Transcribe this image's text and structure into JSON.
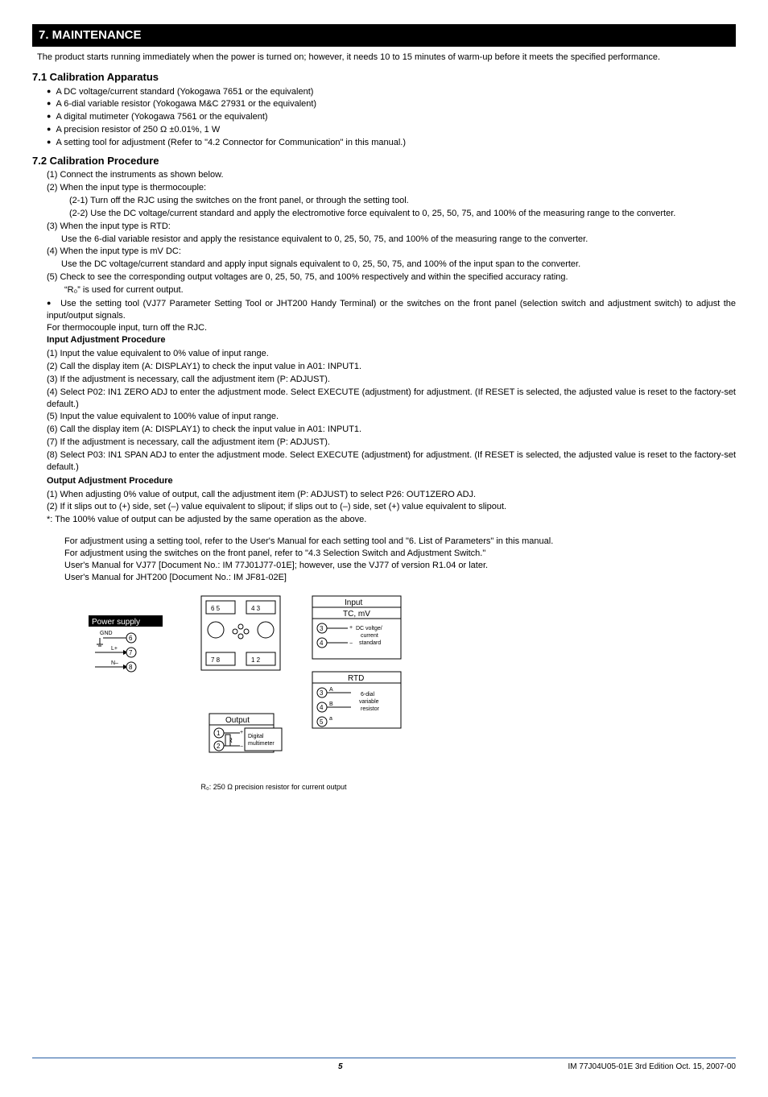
{
  "header": "7. MAINTENANCE",
  "intro": "The product starts running immediately when the power is turned on; however, it needs 10 to 15 minutes of warm-up before it meets the specified performance.",
  "s71": {
    "title": "7.1    Calibration Apparatus",
    "items": [
      "A DC voltage/current standard (Yokogawa 7651 or the equivalent)",
      "A 6-dial variable resistor (Yokogawa M&C 27931 or the equivalent)",
      "A digital mutimeter (Yokogawa 7561 or the equivalent)",
      "A precision resistor of 250 Ω ±0.01%, 1 W",
      "A setting tool for adjustment (Refer to \"4.2 Connector for Communication\" in this manual.)"
    ]
  },
  "s72": {
    "title": "7.2    Calibration Procedure",
    "p1": "(1) Connect the instruments as shown below.",
    "p2": "(2) When the input type is thermocouple:",
    "p2_1": "(2-1) Turn off the RJC using the switches on the front panel, or through the setting tool.",
    "p2_2": "(2-2) Use the DC voltage/current standard and apply the electromotive force equivalent to 0, 25, 50, 75, and 100% of the measuring range to the converter.",
    "p3": "(3) When the input type is RTD:",
    "p3s": "Use the 6-dial variable resistor and apply the resistance equivalent to 0, 25, 50, 75, and 100% of the measuring range to the converter.",
    "p4": "(4) When the input type is mV DC:",
    "p4s": "Use the DC voltage/current standard and apply input signals equivalent to 0, 25, 50, 75, and 100% of the input span to the converter.",
    "p5": "(5) Check to see the corresponding output voltages are 0, 25, 50, 75, and 100% respectively and within the specified accuracy rating.",
    "p5s": "“R₀” is used for current output.",
    "b1": "Use the setting tool (VJ77 Parameter Setting Tool or JHT200 Handy Terminal) or the switches on the front panel (selection switch and adjustment switch) to adjust the input/output signals.",
    "b1s": "For thermocouple input, turn off the RJC.",
    "iap_title": "Input Adjustment Procedure",
    "iap": [
      "(1)  Input the value equivalent to 0% value of input range.",
      "(2)  Call the display item (A: DISPLAY1) to check the input value in A01: INPUT1.",
      "(3)  If the adjustment is necessary, call the adjustment item (P: ADJUST).",
      "(4)  Select P02: IN1 ZERO ADJ to enter the adjustment mode.  Select EXECUTE (adjustment) for adjustment.  (If RESET is selected, the adjusted value is reset to the factory-set default.)",
      "(5)  Input the value equivalent to 100% value of input range.",
      "(6)  Call the display item (A: DISPLAY1) to check the input value in A01: INPUT1.",
      "(7)  If the adjustment is necessary, call the adjustment item (P: ADJUST).",
      "(8)  Select P03: IN1 SPAN ADJ to enter the adjustment mode.  Select EXECUTE (adjustment) for adjustment.  (If RESET is selected, the adjusted value is reset to the factory-set default.)"
    ],
    "oap_title": "Output Adjustment Procedure",
    "oap": [
      "(1)  When adjusting 0% value of output, call the adjustment item (P: ADJUST) to select P26: OUT1ZERO ADJ.",
      "(2)  If it slips out to (+) side, set (–) value equivalent to slipout; if slips out to (–) side, set (+) value equivalent to slipout.",
      "*:   The 100% value of output can be adjusted by the same operation as the above."
    ],
    "notes": [
      "For adjustment using a setting tool, refer to the User's Manual for each setting tool and \"6. List of Parameters\" in this manual.",
      "For adjustment using the switches on the front panel, refer to \"4.3 Selection Switch and Adjustment Switch.\"",
      "User's Manual for VJ77 [Document No.: IM 77J01J77-01E]; however, use the VJ77 of version R1.04 or later.",
      "User's Manual for JHT200 [Document No.: IM JF81-02E]"
    ]
  },
  "diagram": {
    "power_supply": "Power supply",
    "gnd": "GND",
    "l": "L+",
    "n": "N–",
    "output": "Output",
    "digital": "Digital multimeter",
    "r": "R",
    "input": "Input",
    "tcmv": "TC, mV",
    "dcv": "DC voltge/ current standard",
    "rtd": "RTD",
    "sixdial": "6-dial variable resistor",
    "abba": {
      "a": "A",
      "b": "B",
      "a2": "a"
    },
    "caption": "R₀: 250 Ω precision resistor for current output"
  },
  "footer": {
    "page": "5",
    "doc": "IM 77J04U05-01E    3rd Edition   Oct. 15, 2007-00"
  }
}
